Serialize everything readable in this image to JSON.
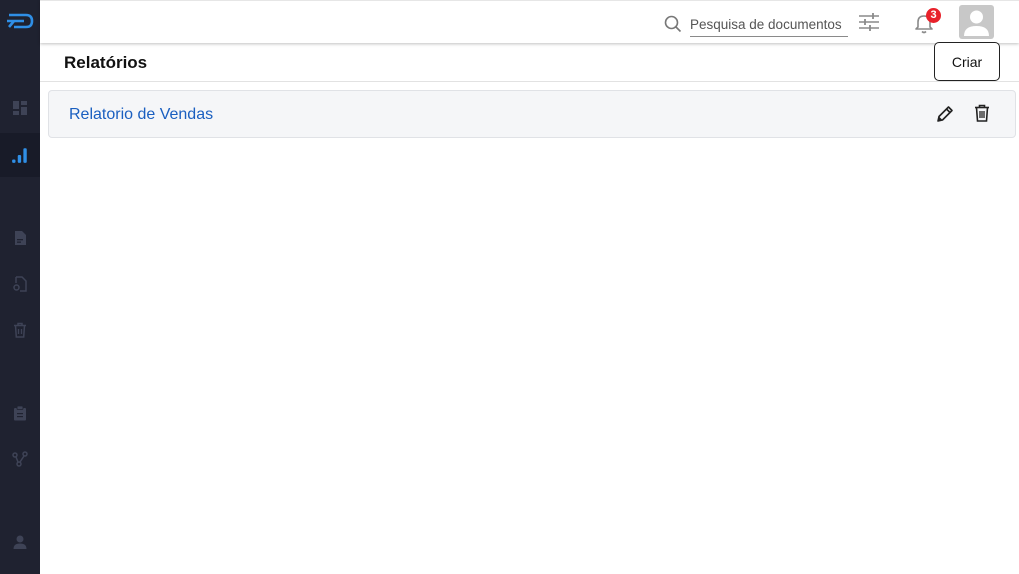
{
  "sidebar": {
    "logo": "pd-logo",
    "items": [
      {
        "icon": "dashboard-icon",
        "active": false
      },
      {
        "icon": "bar-chart-icon",
        "active": true
      },
      {
        "icon": "document-icon",
        "active": false
      },
      {
        "icon": "document-settings-icon",
        "active": false
      },
      {
        "icon": "trash-icon",
        "active": false
      },
      {
        "icon": "clipboard-icon",
        "active": false
      },
      {
        "icon": "flow-icon",
        "active": false
      },
      {
        "icon": "user-icon",
        "active": false
      }
    ],
    "colors": {
      "background": "#1f2230",
      "active_icon": "#2f8fe6",
      "inactive_icon": "#3e4356"
    }
  },
  "topbar": {
    "search": {
      "placeholder": "Pesquisa de documentos",
      "value": ""
    },
    "filter_icon": "sliders-icon",
    "notifications": {
      "icon": "bell-icon",
      "count": "3"
    },
    "avatar_icon": "user-avatar-icon"
  },
  "page": {
    "title": "Relatórios",
    "create_label": "Criar"
  },
  "reports": [
    {
      "name": "Relatorio de Vendas",
      "color": "#1a5fc0"
    }
  ]
}
